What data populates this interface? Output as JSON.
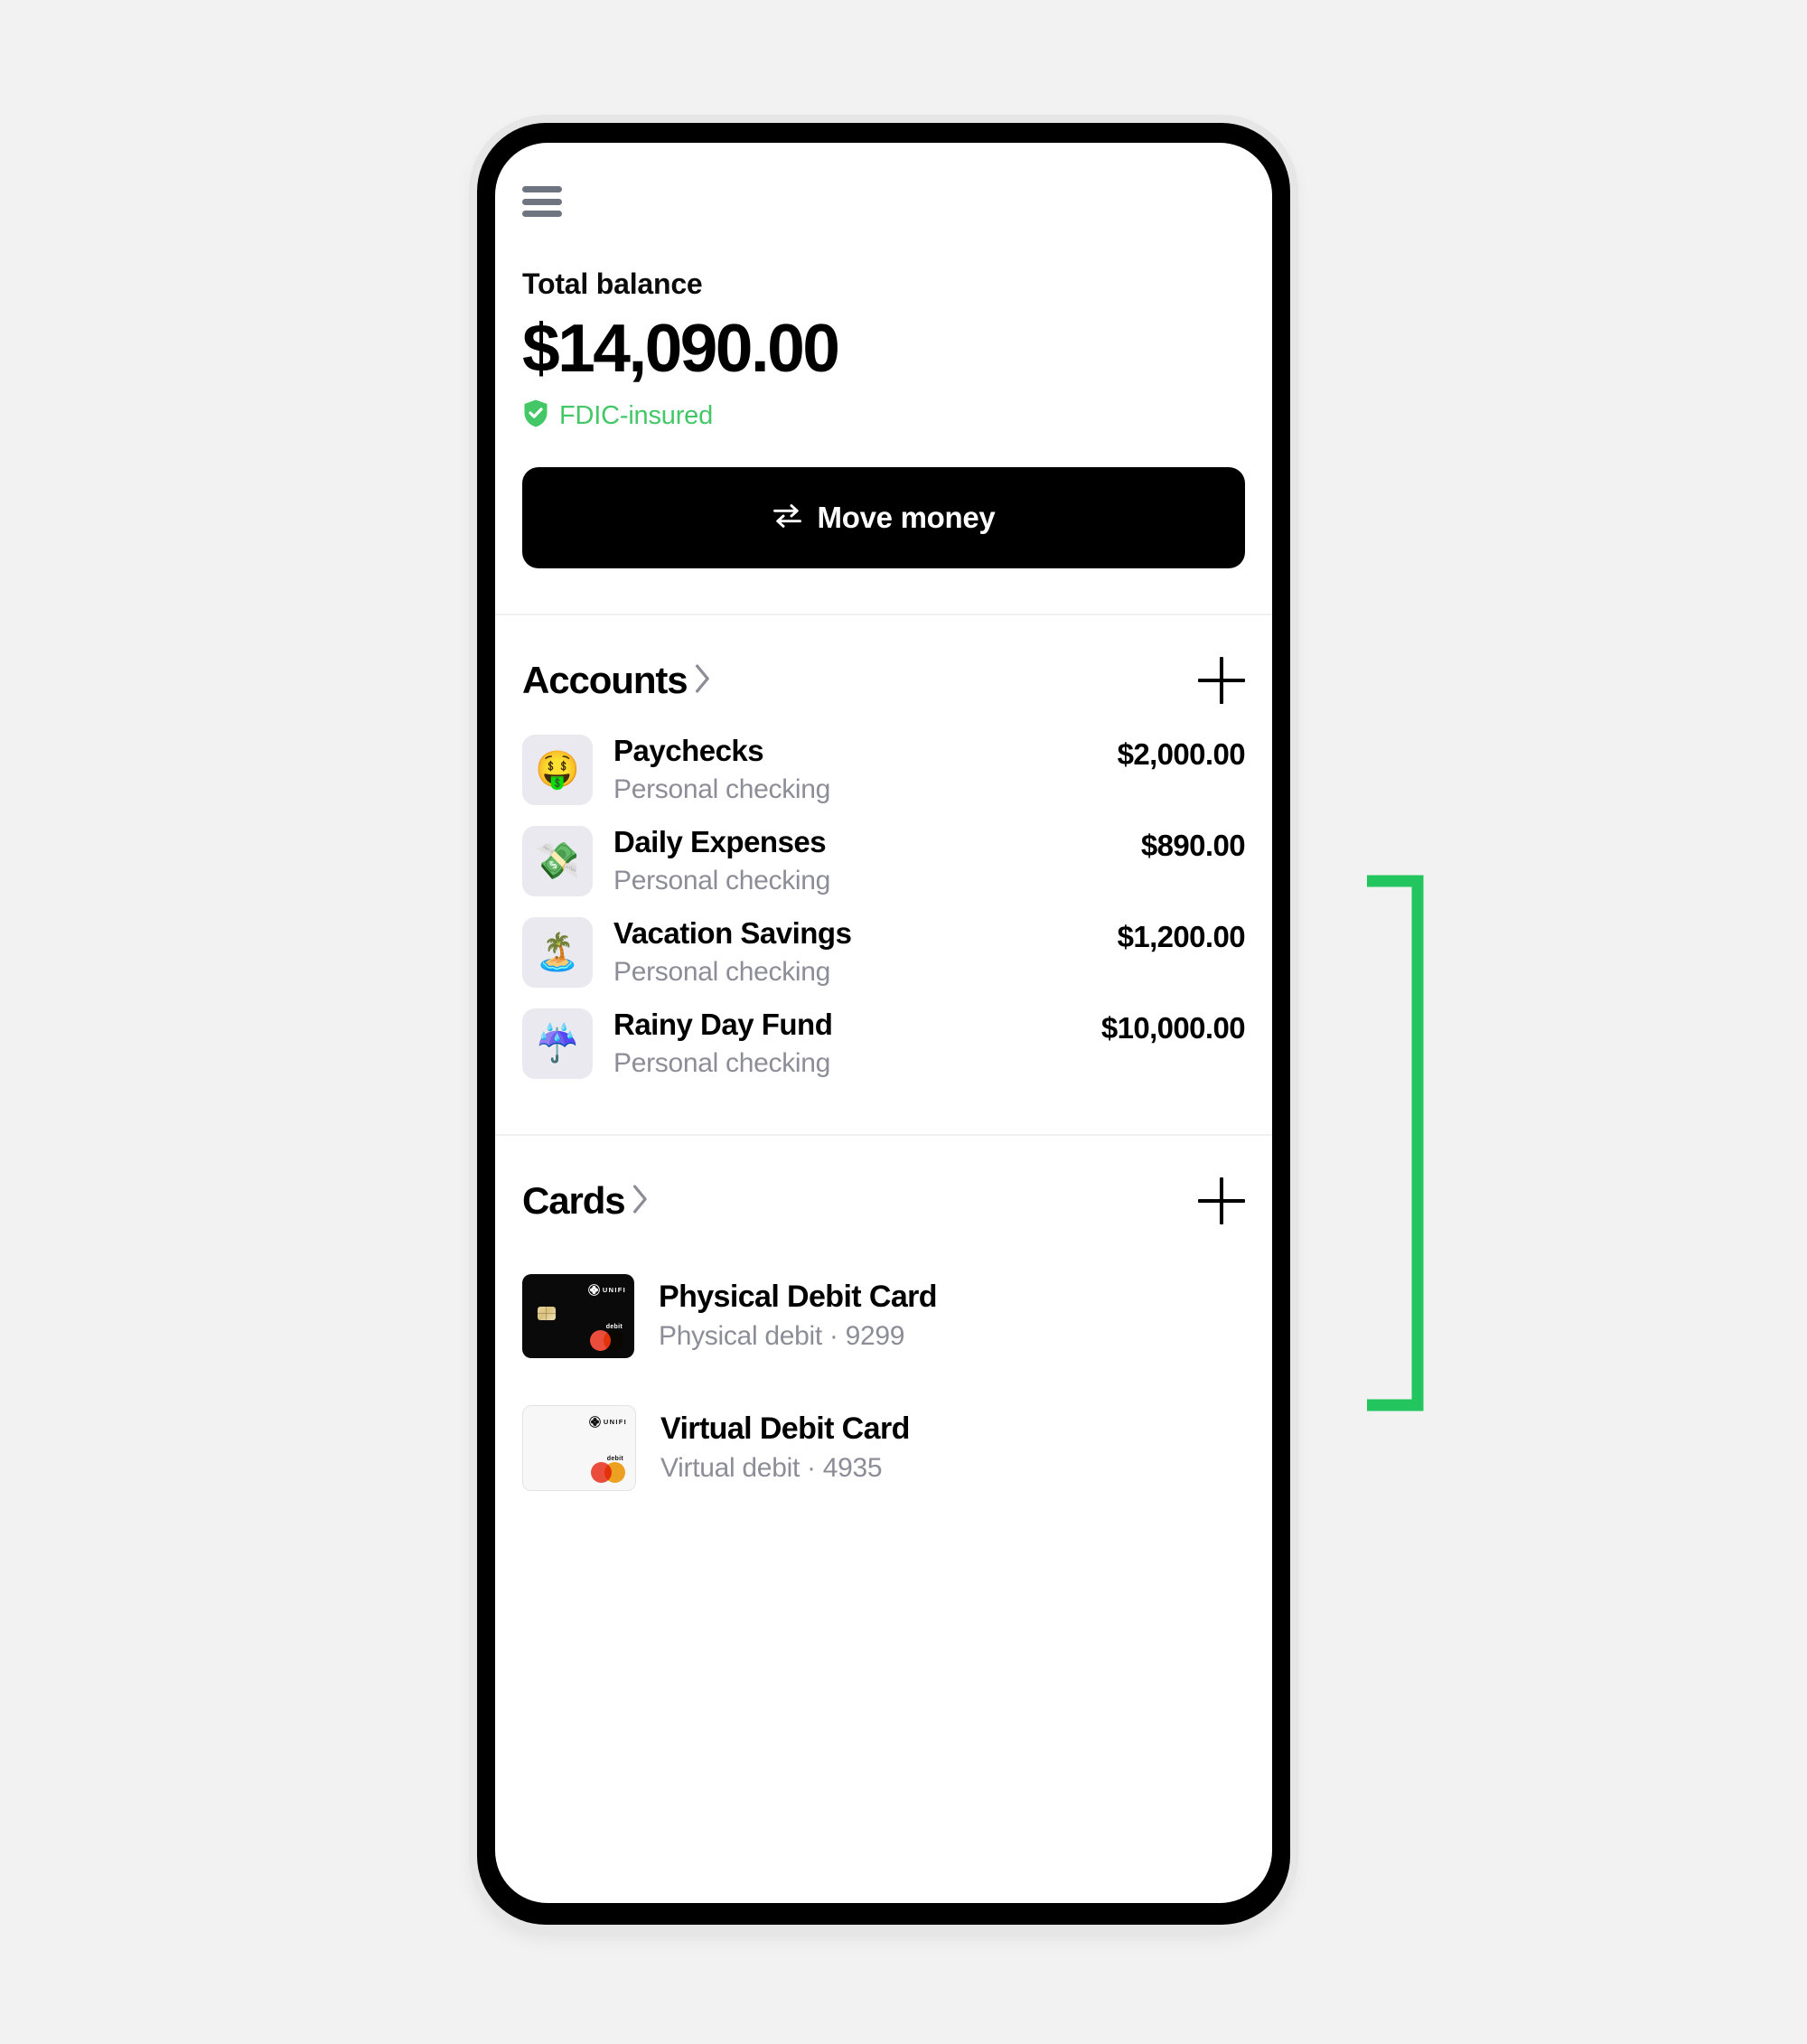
{
  "theme": {
    "accent_green": "#22c55e",
    "fdic_green": "#44c767",
    "button_black": "#000000",
    "muted_text": "#8d8d97",
    "tile_bg": "#e9e9ef"
  },
  "topbar": {
    "menu_icon": "hamburger-menu-icon"
  },
  "balance": {
    "label": "Total balance",
    "amount": "$14,090.00",
    "insurance_badge": "FDIC-insured",
    "insurance_icon": "shield-check-icon"
  },
  "primary_action": {
    "label": "Move money",
    "icon": "transfer-arrows-icon"
  },
  "accounts_section": {
    "title": "Accounts",
    "chevron_icon": "chevron-right-icon",
    "add_icon": "plus-icon",
    "items": [
      {
        "emoji": "🤑",
        "emoji_name": "money-mouth-face-emoji",
        "name": "Paychecks",
        "subtitle": "Personal checking",
        "amount": "$2,000.00"
      },
      {
        "emoji": "💸",
        "emoji_name": "money-with-wings-emoji",
        "name": "Daily Expenses",
        "subtitle": "Personal checking",
        "amount": "$890.00"
      },
      {
        "emoji": "🏝️",
        "emoji_name": "desert-island-emoji",
        "name": "Vacation Savings",
        "subtitle": "Personal checking",
        "amount": "$1,200.00"
      },
      {
        "emoji": "☔",
        "emoji_name": "umbrella-with-rain-emoji",
        "name": "Rainy Day Fund",
        "subtitle": "Personal checking",
        "amount": "$10,000.00"
      }
    ]
  },
  "cards_section": {
    "title": "Cards",
    "chevron_icon": "chevron-right-icon",
    "add_icon": "plus-icon",
    "items": [
      {
        "name": "Physical Debit Card",
        "subtitle": "Physical debit · 9299",
        "art": {
          "style": "dark",
          "brand": "UNIFI",
          "type_label": "debit",
          "network_icon": "mastercard-logo",
          "chip_icon": "emv-chip-icon"
        }
      },
      {
        "name": "Virtual Debit Card",
        "subtitle": "Virtual debit · 4935",
        "art": {
          "style": "light",
          "brand": "UNIFI",
          "type_label": "debit",
          "network_icon": "mastercard-logo",
          "chip_icon": null
        }
      }
    ]
  },
  "annotation": {
    "shape": "right-bracket",
    "color": "#22c55e",
    "covers": "accounts-list"
  }
}
